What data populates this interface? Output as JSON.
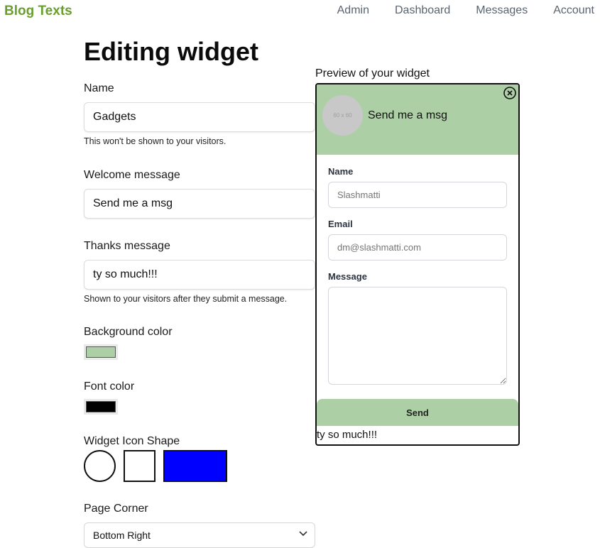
{
  "brand": "Blog Texts",
  "nav": [
    "Admin",
    "Dashboard",
    "Messages",
    "Account"
  ],
  "page_title": "Editing widget",
  "form": {
    "name_label": "Name",
    "name_value": "Gadgets",
    "name_help": "This won't be shown to your visitors.",
    "welcome_label": "Welcome message",
    "welcome_value": "Send me a msg",
    "thanks_label": "Thanks message",
    "thanks_value": "ty so much!!!",
    "thanks_help": "Shown to your visitors after they submit a message.",
    "bg_color_label": "Background color",
    "bg_color": "#adcfa6",
    "font_color_label": "Font color",
    "font_color": "#000000",
    "icon_shape_label": "Widget Icon Shape",
    "selected_shape_color": "#0000ff",
    "corner_label": "Page Corner",
    "corner_value": "Bottom Right"
  },
  "preview": {
    "label": "Preview of your widget",
    "avatar_text": "60 x 60",
    "title": "Send me a msg",
    "name_label": "Name",
    "name_placeholder": "Slashmatti",
    "email_label": "Email",
    "email_placeholder": "dm@slashmatti.com",
    "message_label": "Message",
    "send_label": "Send",
    "thanks_text": "ty so much!!!"
  }
}
